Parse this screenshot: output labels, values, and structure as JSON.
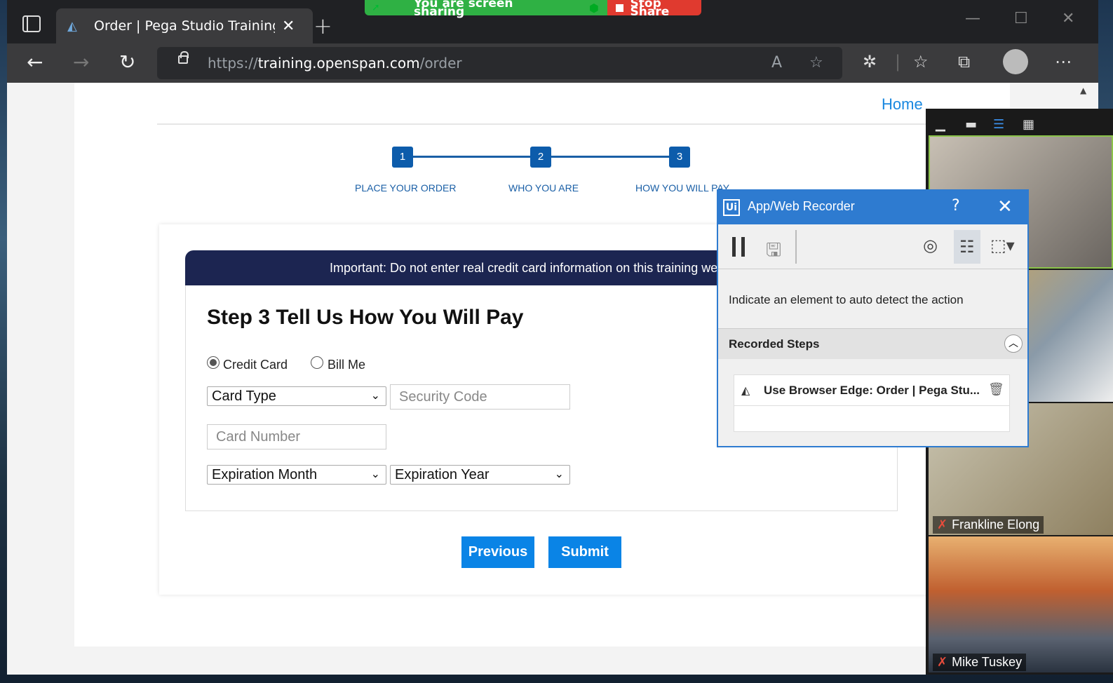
{
  "screen_share": {
    "status_text": "You are screen sharing",
    "stop_label": "Stop Share"
  },
  "browser": {
    "tab_title": "Order | Pega Studio Training Web",
    "url_scheme": "https://",
    "url_host": "training.openspan.com",
    "url_path": "/order"
  },
  "page": {
    "home_link": "Home",
    "steps": [
      {
        "number": "1",
        "label": "PLACE YOUR ORDER"
      },
      {
        "number": "2",
        "label": "WHO YOU ARE"
      },
      {
        "number": "3",
        "label": "HOW YOU WILL PAY"
      }
    ],
    "notice": "Important: Do not enter real credit card information on this training website",
    "form_title": "Step 3 Tell Us How You Will Pay",
    "payment_options": [
      "Credit Card",
      "Bill Me"
    ],
    "selected_payment": "Credit Card",
    "card_type": "Card Type",
    "security_code_placeholder": "Security Code",
    "card_number_placeholder": "Card Number",
    "expiration_month": "Expiration Month",
    "expiration_year": "Expiration Year",
    "previous_label": "Previous",
    "submit_label": "Submit"
  },
  "recorder": {
    "logo": "Ui",
    "title": "App/Web Recorder",
    "help": "?",
    "hint": "Indicate an element to auto detect the action",
    "steps_title": "Recorded Steps",
    "steps": [
      "Use Browser Edge: Order | Pega Stu..."
    ]
  },
  "video_panel": {
    "participants": [
      {
        "name": "Frankline Elong",
        "muted": true
      },
      {
        "name": "Mike Tuskey",
        "muted": true
      }
    ]
  },
  "colors": {
    "accent": "#0a84e6",
    "stepper": "#0d5cab",
    "notice_bg": "#1c2551",
    "recorder_title": "#2e7bd0",
    "share_green": "#2fb144",
    "stop_red": "#e03a2f"
  }
}
